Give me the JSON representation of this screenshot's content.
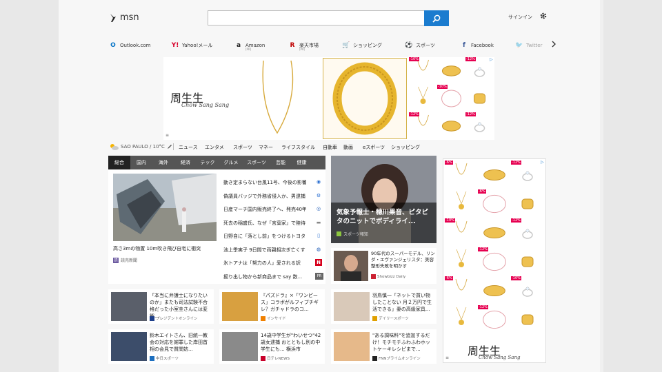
{
  "header": {
    "logo_text": "msn",
    "search_value": "",
    "signin": "サインイン"
  },
  "quicklinks": [
    {
      "label": "Outlook.com",
      "sub": "",
      "icon": "outlook-icon",
      "color": "#0072c6",
      "glyph": "O"
    },
    {
      "label": "Yahoo!メール",
      "sub": "",
      "icon": "yahoo-icon",
      "color": "#d7002a",
      "glyph": "Y!"
    },
    {
      "label": "Amazon",
      "sub": "[PR]",
      "icon": "amazon-icon",
      "color": "#222",
      "glyph": "a"
    },
    {
      "label": "楽天市場",
      "sub": "[PR]",
      "icon": "rakuten-icon",
      "color": "#bf0000",
      "glyph": "R"
    },
    {
      "label": "ショッピング",
      "sub": "",
      "icon": "cart-icon",
      "color": "#1f3f8f",
      "glyph": "🛒"
    },
    {
      "label": "スポーツ",
      "sub": "",
      "icon": "sports-icon",
      "color": "#1f3f8f",
      "glyph": "⚽"
    },
    {
      "label": "Facebook",
      "sub": "",
      "icon": "facebook-icon",
      "color": "#3b5998",
      "glyph": "f"
    },
    {
      "label": "Twitter",
      "sub": "",
      "icon": "twitter-icon",
      "color": "#1da1f2",
      "glyph": "🐦"
    }
  ],
  "ad_top": {
    "brand_kanji": "周生生",
    "brand_latin": "Chow Sang Sang",
    "badges": [
      "-10%",
      "-12%",
      "-10%",
      "-12%",
      "-12%",
      "-10%"
    ]
  },
  "ad_side": {
    "brand_kanji": "周生生",
    "brand_latin": "Chow Sang Sang",
    "badges": [
      "-6%",
      "-12%",
      "-6%",
      "-10%",
      "-12%",
      "-12%",
      "-6%",
      "-10%",
      "-12%",
      "-10%",
      "-12%",
      "-10%"
    ]
  },
  "weather": {
    "text": "SAO PAULO / 10°C"
  },
  "categories": [
    "ニュース",
    "エンタメ",
    "スポーツ",
    "マネー",
    "ライフスタイル",
    "自動車",
    "動画",
    "eスポーツ",
    "ショッピング"
  ],
  "news_tabs": [
    "総合",
    "国内",
    "海外",
    "経済",
    "テック",
    "グルメ",
    "スポーツ",
    "芸能",
    "健康"
  ],
  "main_story": {
    "caption": "高さ3mの物置 10m吹き飛び自宅に衝突",
    "source": "読売新聞"
  },
  "headlines": [
    {
      "text": "動き定まらない台風11号、今後の影響",
      "icon": "cloud-icon",
      "color": "#2a6fd1",
      "glyph": "◉"
    },
    {
      "text": "偽議員バッジで外務省侵入か、男逮捕",
      "icon": "badge-icon",
      "color": "#2a6fd1",
      "glyph": "⚙"
    },
    {
      "text": "日産マーチ国内販売終了へ、発売40年",
      "icon": "car-icon",
      "color": "#1a58b5",
      "glyph": "◎"
    },
    {
      "text": "死去の稲盛氏、なぜ「言葉家」で陸待",
      "icon": "news-icon",
      "color": "#888",
      "glyph": "▬"
    },
    {
      "text": "日野自に「落とし前」をつけるトヨタ",
      "icon": "doc-icon",
      "color": "#2a6fd1",
      "glyph": "▯"
    },
    {
      "text": "池上季実子 9日間で両親相次ぎ亡くす",
      "icon": "person-icon",
      "color": "#1a58b5",
      "glyph": "◍"
    },
    {
      "text": "氷トアナは「努力の人」愛される訳",
      "icon": "n-icon",
      "color": "#d6001c",
      "glyph": "N"
    },
    {
      "text": "掘り出し物から新商品まで say 数...",
      "icon": "pr-icon",
      "color": "#666",
      "glyph": "PR"
    }
  ],
  "feature": {
    "title": "気象予報士・穂川果音、ピタピタのニットでボディライ...",
    "source": "スポーツ報知"
  },
  "feature_small": {
    "title": "90年代のスーパーモデル、リンダ・エヴァンジェリスタ：美容整形失敗を明かす",
    "source": "Showbizz Daily"
  },
  "cards": [
    {
      "title": "「本当に弁護士になりたいのか」またも司法試験不合格だった小室圭さんには変態...",
      "source": "プレジデントオンライン",
      "src_color": "#1d3f8a",
      "thumb": "#5a5f6a"
    },
    {
      "title": "『パズドラ』×「ワンピース」コラボがルフィブチギレ？ガチャドラのコ...",
      "source": "インサイド",
      "src_color": "#f08000",
      "thumb": "#d8a040"
    },
    {
      "title": "羽鳥慎一「ネットで買い物したことない 月２万円で生活できる」妻の高級家具...",
      "source": "デイリースポーツ",
      "src_color": "#e0a000",
      "thumb": "#d9c9b9"
    },
    {
      "title": "鈴木エイトさん、旧統一教会の対応を謝罪した岸田首相の会見で質問妨...",
      "source": "中日スポーツ",
      "src_color": "#1d6fbf",
      "thumb": "#3c4d6a"
    },
    {
      "title": "14歳中学生が\"わいせつ\"42歳女逮捕 おとともし別の中学生にも... 横浜市",
      "source": "日テレNEWS",
      "src_color": "#c8002a",
      "thumb": "#8a8a8a"
    },
    {
      "title": "\"ある調味料\"を追加するだけ！モチモチふわふわホットケーキレシピまで...",
      "source": "FNNプライムオンライン",
      "src_color": "#222",
      "thumb": "#e6b98a"
    }
  ]
}
